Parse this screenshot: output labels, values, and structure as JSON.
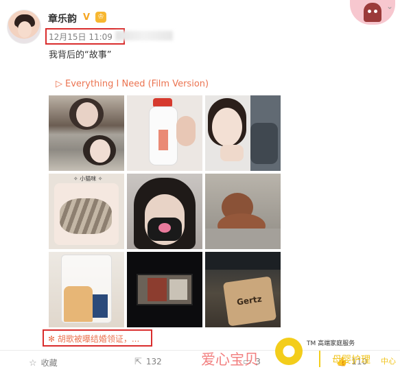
{
  "post": {
    "username": "章乐韵",
    "verified_mark": "V",
    "level_badge": "♔",
    "timestamp": "12月15日 11:09",
    "text": "我背后的“故事”",
    "music": {
      "play_glyph": "▷",
      "title": "Everything I Need (Film Version)"
    },
    "highlighted_link": "✻ 胡歌被曝结婚领证，..."
  },
  "photos": {
    "count": 9,
    "cell2_stamp": "",
    "cell4_label": "✧ 小猫咪 ✧",
    "cell7_tag": "",
    "cell9_bag_text": "Gertz"
  },
  "actions": {
    "favorite": {
      "icon": "star-icon",
      "label": "收藏"
    },
    "repost": {
      "icon": "repost-icon",
      "count": "132"
    },
    "comment": {
      "icon": "comment-icon",
      "count": "3"
    },
    "like": {
      "icon": "like-icon",
      "count": "110"
    }
  },
  "watermark": {
    "name": "爱心宝贝",
    "tagline": "TM 高端家庭服务",
    "service": "母婴护理",
    "suffix": "中心"
  },
  "colors": {
    "accent_orange": "#eb7350",
    "highlight_red": "#d92c2c",
    "badge_gold": "#f5a623",
    "watermark_yellow": "#f0c31a"
  }
}
